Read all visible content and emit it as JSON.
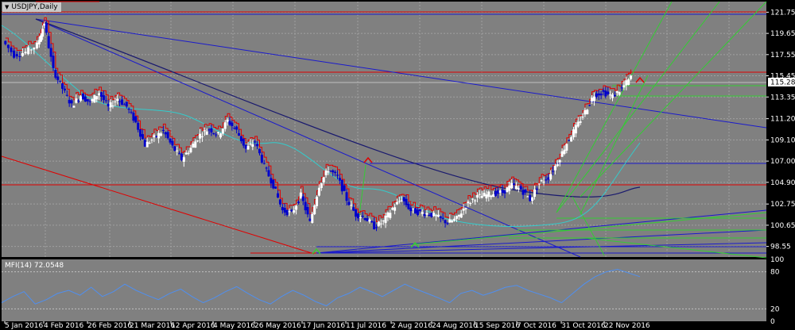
{
  "chart_title": "USDJPY,Daily",
  "indicator_label": "MFI(14) 72.0548",
  "current_price": "115.28",
  "colors": {
    "background": "#808080",
    "frame": "#000000",
    "bull_candle": "#ffffff",
    "bear_candle": "#0000cc",
    "red_line": "#e00000",
    "blue_line": "#1a1acc",
    "navy_line": "#1a1a6e",
    "green_line": "#33cc33",
    "cyan_line": "#33cccc",
    "mfi_line": "#4f8ff0"
  },
  "chart_data": [
    {
      "type": "candlestick",
      "symbol": "USDJPY",
      "timeframe": "Daily",
      "ylim": [
        97.5,
        122.8
      ],
      "y_ticks": [
        "121.75",
        "119.65",
        "117.55",
        "115.45",
        "113.35",
        "111.20",
        "109.10",
        "107.00",
        "104.90",
        "102.75",
        "100.65",
        "98.55"
      ],
      "x_ticks": [
        "5 Jan 2016",
        "4 Feb 2016",
        "26 Feb 2016",
        "21 Mar 2016",
        "12 Apr 2016",
        "4 May 2016",
        "26 May 2016",
        "17 Jun 2016",
        "11 Jul 2016",
        "2 Aug 2016",
        "24 Aug 2016",
        "15 Sep 2016",
        "7 Oct 2016",
        "31 Oct 2016",
        "22 Nov 2016"
      ],
      "close_path": [
        {
          "x": 0,
          "y": 118.9
        },
        {
          "x": 5,
          "y": 117.5
        },
        {
          "x": 10,
          "y": 117.8
        },
        {
          "x": 15,
          "y": 118.5
        },
        {
          "x": 18,
          "y": 120.7
        },
        {
          "x": 22,
          "y": 116.0
        },
        {
          "x": 26,
          "y": 114.2
        },
        {
          "x": 30,
          "y": 112.5
        },
        {
          "x": 34,
          "y": 113.5
        },
        {
          "x": 38,
          "y": 112.8
        },
        {
          "x": 42,
          "y": 113.8
        },
        {
          "x": 46,
          "y": 112.3
        },
        {
          "x": 50,
          "y": 113.2
        },
        {
          "x": 54,
          "y": 112.4
        },
        {
          "x": 58,
          "y": 110.8
        },
        {
          "x": 62,
          "y": 108.6
        },
        {
          "x": 66,
          "y": 109.3
        },
        {
          "x": 70,
          "y": 110.0
        },
        {
          "x": 74,
          "y": 108.4
        },
        {
          "x": 78,
          "y": 107.2
        },
        {
          "x": 82,
          "y": 108.3
        },
        {
          "x": 86,
          "y": 109.6
        },
        {
          "x": 90,
          "y": 110.2
        },
        {
          "x": 94,
          "y": 109.6
        },
        {
          "x": 98,
          "y": 111.0
        },
        {
          "x": 102,
          "y": 110.0
        },
        {
          "x": 106,
          "y": 108.2
        },
        {
          "x": 110,
          "y": 108.9
        },
        {
          "x": 114,
          "y": 106.5
        },
        {
          "x": 118,
          "y": 104.6
        },
        {
          "x": 122,
          "y": 102.1
        },
        {
          "x": 126,
          "y": 101.8
        },
        {
          "x": 130,
          "y": 103.6
        },
        {
          "x": 134,
          "y": 100.9
        },
        {
          "x": 138,
          "y": 104.6
        },
        {
          "x": 142,
          "y": 106.2
        },
        {
          "x": 146,
          "y": 105.4
        },
        {
          "x": 150,
          "y": 103.2
        },
        {
          "x": 154,
          "y": 101.7
        },
        {
          "x": 158,
          "y": 101.4
        },
        {
          "x": 162,
          "y": 100.5
        },
        {
          "x": 166,
          "y": 101.0
        },
        {
          "x": 170,
          "y": 102.3
        },
        {
          "x": 174,
          "y": 103.3
        },
        {
          "x": 178,
          "y": 102.1
        },
        {
          "x": 182,
          "y": 101.9
        },
        {
          "x": 186,
          "y": 101.8
        },
        {
          "x": 190,
          "y": 101.4
        },
        {
          "x": 194,
          "y": 100.9
        },
        {
          "x": 198,
          "y": 101.3
        },
        {
          "x": 202,
          "y": 102.6
        },
        {
          "x": 206,
          "y": 103.4
        },
        {
          "x": 210,
          "y": 103.6
        },
        {
          "x": 214,
          "y": 103.8
        },
        {
          "x": 218,
          "y": 103.9
        },
        {
          "x": 222,
          "y": 104.6
        },
        {
          "x": 226,
          "y": 104.2
        },
        {
          "x": 230,
          "y": 103.2
        },
        {
          "x": 234,
          "y": 104.8
        },
        {
          "x": 238,
          "y": 105.4
        },
        {
          "x": 242,
          "y": 106.9
        },
        {
          "x": 246,
          "y": 108.8
        },
        {
          "x": 250,
          "y": 110.3
        },
        {
          "x": 254,
          "y": 111.9
        },
        {
          "x": 258,
          "y": 113.6
        },
        {
          "x": 262,
          "y": 113.8
        },
        {
          "x": 266,
          "y": 113.4
        },
        {
          "x": 270,
          "y": 114.2
        },
        {
          "x": 274,
          "y": 115.28
        }
      ]
    },
    {
      "type": "line",
      "indicator": "MFI(14)",
      "value": 72.0548,
      "ylim": [
        0,
        100
      ],
      "y_ticks": [
        "100",
        "80",
        "20",
        "0"
      ],
      "series": [
        {
          "values": [
            30,
            40,
            48,
            28,
            35,
            45,
            50,
            42,
            55,
            40,
            48,
            60,
            50,
            42,
            35,
            45,
            52,
            40,
            30,
            38,
            48,
            56,
            45,
            35,
            28,
            40,
            50,
            42,
            32,
            25,
            38,
            45,
            55,
            48,
            40,
            50,
            60,
            52,
            45,
            38,
            30,
            45,
            50,
            42,
            48,
            55,
            58,
            50,
            44,
            38,
            30,
            45,
            60,
            72,
            80,
            84,
            78,
            72
          ]
        }
      ]
    }
  ]
}
